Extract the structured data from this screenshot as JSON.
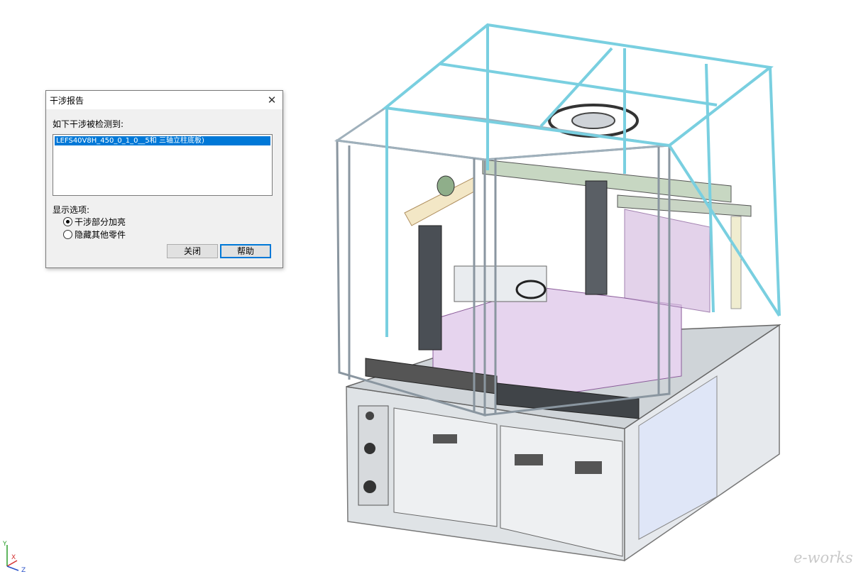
{
  "dialog": {
    "title": "干涉报告",
    "prompt": "如下干涉被检测到:",
    "interferences": [
      "LEFS40V8H_450_0_1_0__5和 三轴立柱底板)"
    ],
    "display_options_label": "显示选项:",
    "options": [
      {
        "label": "干涉部分加亮",
        "checked": true
      },
      {
        "label": "隐藏其他零件",
        "checked": false
      }
    ],
    "close_label": "关闭",
    "help_label": "帮助"
  },
  "axes": {
    "y": "Y",
    "x": "X",
    "z": "Z"
  },
  "logo": "e-works",
  "icons": {
    "close": "close-icon",
    "triad": "coordinate-triad-icon"
  },
  "colors": {
    "frame_cyan": "#79cfe0",
    "selection": "#0078d7",
    "magenta_parts": "#c25bd0"
  }
}
